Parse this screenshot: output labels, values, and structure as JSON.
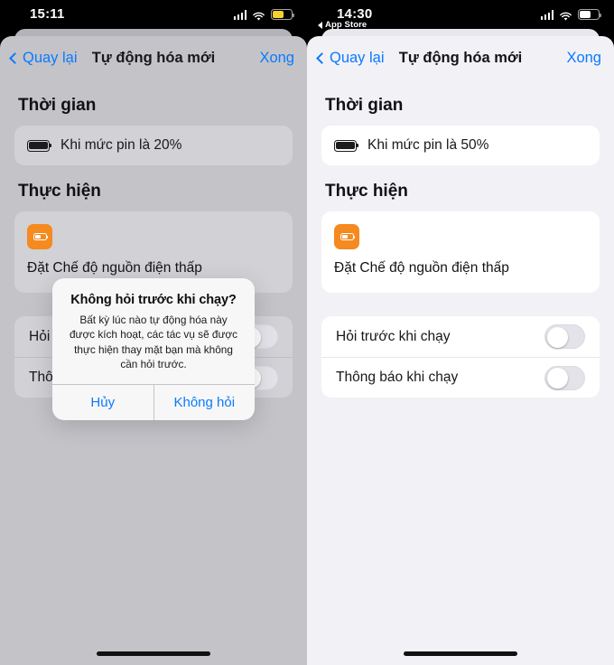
{
  "panels": [
    {
      "id": "left",
      "status": {
        "time": "15:11",
        "back_app": "",
        "battery_color": "#f5d130",
        "battery_level": 62
      },
      "nav": {
        "back": "Quay lại",
        "title": "Tự động hóa mới",
        "done": "Xong"
      },
      "sections": {
        "time_title": "Thời gian",
        "when_text": "Khi mức pin là 20%",
        "action_title": "Thực hiện",
        "action_text": "Đặt Chế độ nguồn điện thấp"
      },
      "toggles": [
        {
          "label": "Hỏi trước khi chạy",
          "on": false
        },
        {
          "label": "Thông báo khi chạy",
          "on": false
        }
      ],
      "alert": {
        "title": "Không hỏi trước khi chạy?",
        "message": "Bất kỳ lúc nào tự động hóa này được kích hoạt, các tác vụ sẽ được thực hiện thay mặt bạn mà không cần hỏi trước.",
        "cancel": "Hủy",
        "confirm": "Không hỏi"
      }
    },
    {
      "id": "right",
      "status": {
        "time": "14:30",
        "back_app": "App Store",
        "battery_color": "#ffffff",
        "battery_level": 58
      },
      "nav": {
        "back": "Quay lại",
        "title": "Tự động hóa mới",
        "done": "Xong"
      },
      "sections": {
        "time_title": "Thời gian",
        "when_text": "Khi mức pin là 50%",
        "action_title": "Thực hiện",
        "action_text": "Đặt Chế độ nguồn điện thấp"
      },
      "toggles": [
        {
          "label": "Hỏi trước khi chạy",
          "on": false
        },
        {
          "label": "Thông báo khi chạy",
          "on": false
        }
      ],
      "alert": null
    }
  ],
  "colors": {
    "accent": "#0a7aff",
    "action_icon": "#f58a1f",
    "dimmed_bg": "#c4c3c8",
    "light_bg": "#f2f1f6"
  },
  "icons": {
    "signal": "cellular-signal-icon",
    "wifi": "wifi-icon",
    "battery": "battery-icon",
    "back_chevron": "chevron-left-icon",
    "action": "low-power-mode-icon"
  }
}
